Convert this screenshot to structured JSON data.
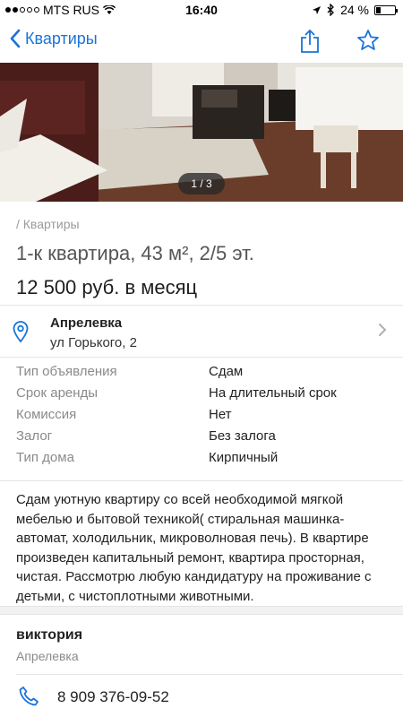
{
  "status": {
    "carrier": "MTS RUS",
    "time": "16:40",
    "battery": "24 %",
    "battery_level": 0.24
  },
  "nav": {
    "back_label": "Квартиры",
    "share_icon": "share-icon",
    "favorite_icon": "star-icon"
  },
  "gallery": {
    "counter": "1 / 3"
  },
  "listing": {
    "breadcrumb": "/ Квартиры",
    "title": "1-к квартира, 43 м², 2/5 эт.",
    "price": "12 500 руб. в месяц"
  },
  "location": {
    "city": "Апрелевка",
    "street": "ул Горького, 2"
  },
  "params": [
    {
      "label": "Тип объявления",
      "value": "Сдам"
    },
    {
      "label": "Срок аренды",
      "value": "На длительный срок"
    },
    {
      "label": "Комиссия",
      "value": "Нет"
    },
    {
      "label": "Залог",
      "value": "Без залога"
    },
    {
      "label": "Тип дома",
      "value": "Кирпичный"
    }
  ],
  "description": "Сдам уютную квартиру со всей необходимой мягкой мебелью и бытовой техникой( стиральная машинка-автомат, холодильник, микроволновая печь). В квартире произведен капитальный ремонт, квартира просторная, чистая. Рассмотрю любую кандидатуру на проживание с детьми, с чистоплотными животными.",
  "seller": {
    "name": "виктория",
    "city": "Апрелевка",
    "phone": "8 909 376-09-52"
  },
  "colors": {
    "accent": "#1a73d9",
    "muted": "#8a8a8a"
  }
}
